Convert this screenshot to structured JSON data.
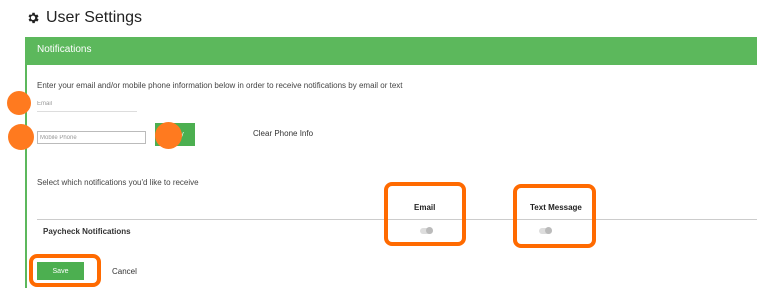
{
  "header": {
    "title": "User Settings",
    "icon": "gear-icon"
  },
  "notifications": {
    "panel_title": "Notifications",
    "instructions": "Enter your email and/or mobile phone information below in order to receive notifications by email or text",
    "email_placeholder": "Email",
    "phone_placeholder": "Mobile Phone",
    "verify_label": "Verify",
    "clear_phone_label": "Clear Phone Info",
    "select_text": "Select which notifications you'd like to receive",
    "columns": [
      "Email",
      "Text Message"
    ],
    "rows": [
      {
        "label": "Paycheck Notifications",
        "email_enabled": false,
        "text_enabled": false
      }
    ]
  },
  "actions": {
    "save_label": "Save",
    "cancel_label": "Cancel"
  },
  "colors": {
    "accent": "#5cb85c",
    "highlight": "#ff6a00"
  }
}
